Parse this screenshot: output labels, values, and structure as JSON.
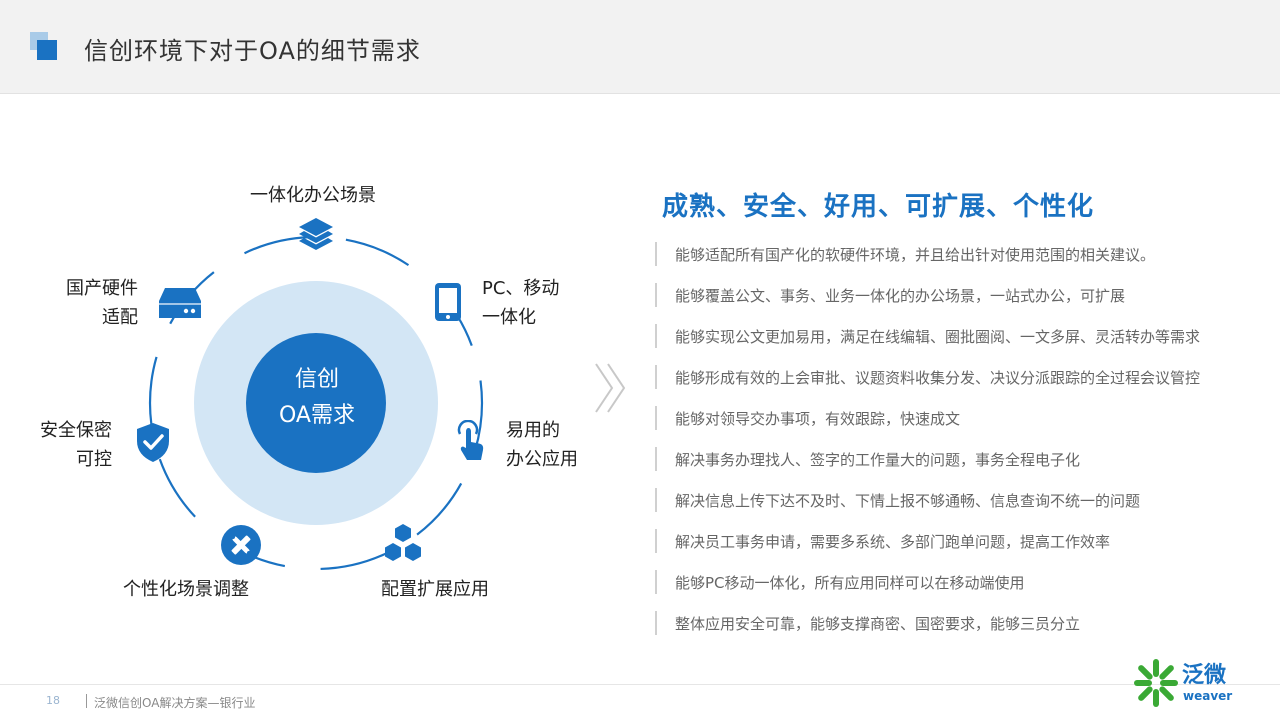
{
  "header": {
    "title": "信创环境下对于OA的细节需求"
  },
  "cycle": {
    "center_line1": "信创",
    "center_line2": "OA需求",
    "nodes": [
      {
        "icon": "layers-icon",
        "label_lines": [
          "一体化办公场景"
        ]
      },
      {
        "icon": "tablet-icon",
        "label_lines": [
          "PC、移动",
          "一体化"
        ]
      },
      {
        "icon": "pointer-icon",
        "label_lines": [
          "易用的",
          "办公应用"
        ]
      },
      {
        "icon": "hexagons-icon",
        "label_lines": [
          "配置扩展应用"
        ]
      },
      {
        "icon": "tools-icon",
        "label_lines": [
          "个性化场景调整"
        ]
      },
      {
        "icon": "shield-check-icon",
        "label_lines": [
          "安全保密",
          "可控"
        ]
      },
      {
        "icon": "hard-drive-icon",
        "label_lines": [
          "国产硬件",
          "适配"
        ]
      }
    ]
  },
  "right": {
    "title": "成熟、安全、好用、可扩展、个性化",
    "items": [
      "能够适配所有国产化的软硬件环境，并且给出针对使用范围的相关建议。",
      "能够覆盖公文、事务、业务一体化的办公场景，一站式办公，可扩展",
      "能够实现公文更加易用，满足在线编辑、圈批圈阅、一文多屏、灵活转办等需求",
      "能够形成有效的上会审批、议题资料收集分发、决议分派跟踪的全过程会议管控",
      "能够对领导交办事项，有效跟踪，快速成文",
      "解决事务办理找人、签字的工作量大的问题，事务全程电子化",
      "解决信息上传下达不及时、下情上报不够通畅、信息查询不统一的问题",
      "解决员工事务申请，需要多系统、多部门跑单问题，提高工作效率",
      "能够PC移动一体化，所有应用同样可以在移动端使用",
      "整体应用安全可靠，能够支撑商密、国密要求，能够三员分立"
    ]
  },
  "footer": {
    "page": "18",
    "text": "泛微信创OA解决方案—银行业"
  },
  "logo": {
    "cn": "泛微",
    "en": "weaver"
  },
  "colors": {
    "accent": "#1a72c2",
    "halo": "#d3e6f5",
    "chevron": "#c8c8c8"
  }
}
